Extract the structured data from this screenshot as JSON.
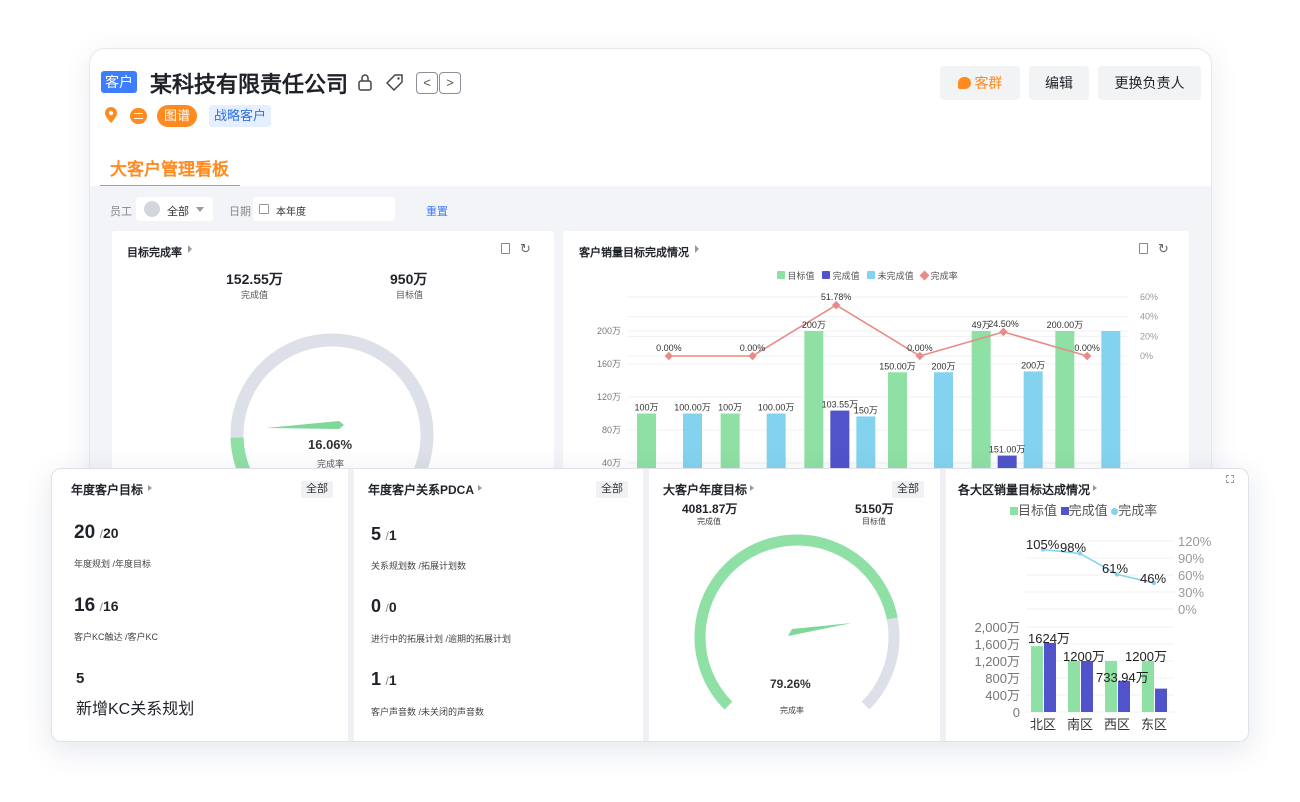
{
  "colors": {
    "brand_blue": "#3d7dff",
    "orange": "#ff8a1f",
    "green": "#8fe0a4",
    "indigo": "#5053c9",
    "sky": "#83d3ef",
    "red_line": "#ea8a86",
    "gauge_track": "#dde0e8"
  },
  "header": {
    "tag": "客户",
    "company": "某科技有限责任公司",
    "icons": [
      "lock-icon",
      "tag-icon"
    ],
    "pill_graph": "图谱",
    "pill_strategy": "战略客户",
    "btn_group": "客群",
    "btn_edit": "编辑",
    "btn_owner": "更换负责人"
  },
  "tabs": {
    "active": "大客户管理看板"
  },
  "filters": {
    "employee_label": "员工",
    "employee_value": "全部",
    "date_label": "日期",
    "date_value": "本年度",
    "reset": "重置"
  },
  "target_card": {
    "title": "目标完成率",
    "done_value": "152.55万",
    "done_label": "完成值",
    "target_value": "950万",
    "target_label": "目标值",
    "percent_text": "16.06%",
    "percent": 0.1606,
    "caption": "完成率"
  },
  "sales_card": {
    "title": "客户销量目标完成情况",
    "legend": [
      "目标值",
      "完成值",
      "未完成值",
      "完成率"
    ],
    "left_axis": [
      "200万",
      "160万",
      "120万",
      "80万",
      "40万"
    ],
    "right_axis": [
      "60%",
      "40%",
      "20%",
      "0%"
    ],
    "rate_labels": [
      "0.00%",
      "0.00%",
      "51.78%",
      "0.00%",
      "24.50%",
      "0.00%"
    ],
    "bar_labels": [
      "100万",
      "100.00万",
      "100万",
      "100.00万",
      "200万",
      "103.55万",
      "150万",
      "150.00万",
      "200万",
      "49万",
      "151.00万",
      "200万",
      "200.00万"
    ]
  },
  "annual_goal": {
    "title": "年度客户目标",
    "all": "全部",
    "rows": [
      {
        "a": "20",
        "b": "20",
        "label": "年度规划 /年度目标"
      },
      {
        "a": "16",
        "b": "16",
        "label": "客户KC触达 /客户KC"
      },
      {
        "a": "5",
        "label": "新增KC关系规划"
      }
    ]
  },
  "pdca": {
    "title": "年度客户关系PDCA",
    "all": "全部",
    "rows": [
      {
        "a": "5",
        "b": "1",
        "label": "关系规划数 /拓展计划数"
      },
      {
        "a": "0",
        "b": "0",
        "label": "进行中的拓展计划 /逾期的拓展计划"
      },
      {
        "a": "1",
        "b": "1",
        "label": "客户声音数 /未关闭的声音数"
      }
    ]
  },
  "big_goal": {
    "title": "大客户年度目标",
    "all": "全部",
    "done_value": "4081.87万",
    "done_label": "完成值",
    "target_value": "5150万",
    "target_label": "目标值",
    "percent_text": "79.26%",
    "percent": 0.7926,
    "caption": "完成率"
  },
  "region_card": {
    "title": "各大区销量目标达成情况",
    "legend": [
      "目标值",
      "完成值",
      "完成率"
    ]
  },
  "chart_data": [
    {
      "type": "bar",
      "title": "客户销量目标完成情况",
      "categories": [
        "",
        "",
        "",
        "",
        "",
        ""
      ],
      "series": [
        {
          "name": "目标值",
          "values": [
            100,
            100,
            200,
            150,
            200,
            200
          ]
        },
        {
          "name": "完成值",
          "values": [
            0,
            0,
            103.55,
            0,
            49,
            0
          ]
        },
        {
          "name": "未完成值",
          "values": [
            100,
            100,
            96.45,
            150,
            151,
            200
          ]
        },
        {
          "name": "完成率",
          "values": [
            0,
            0,
            51.78,
            0,
            24.5,
            0
          ]
        }
      ],
      "ylim": [
        0,
        200
      ],
      "y2lim": [
        0,
        60
      ]
    },
    {
      "type": "bar",
      "title": "各大区销量目标达成情况",
      "categories": [
        "北区",
        "南区",
        "西区",
        "东区"
      ],
      "series": [
        {
          "name": "目标值",
          "values": [
            1550,
            1200,
            1200,
            1200
          ]
        },
        {
          "name": "完成值",
          "values": [
            1624,
            1200,
            733.94,
            550
          ]
        },
        {
          "name": "完成率",
          "values": [
            105,
            98,
            61,
            46
          ]
        }
      ],
      "bar_labels": [
        "1624万",
        "1200万",
        "733.94万",
        "1200万"
      ],
      "rate_labels": [
        "105%",
        "98%",
        "61%",
        "46%"
      ],
      "left_axis": [
        "2,000万",
        "1,600万",
        "1,200万",
        "800万",
        "400万",
        "0"
      ],
      "right_axis": [
        "120%",
        "90%",
        "60%",
        "30%",
        "0%"
      ],
      "ylim": [
        0,
        2000
      ],
      "y2lim": [
        0,
        120
      ]
    }
  ]
}
